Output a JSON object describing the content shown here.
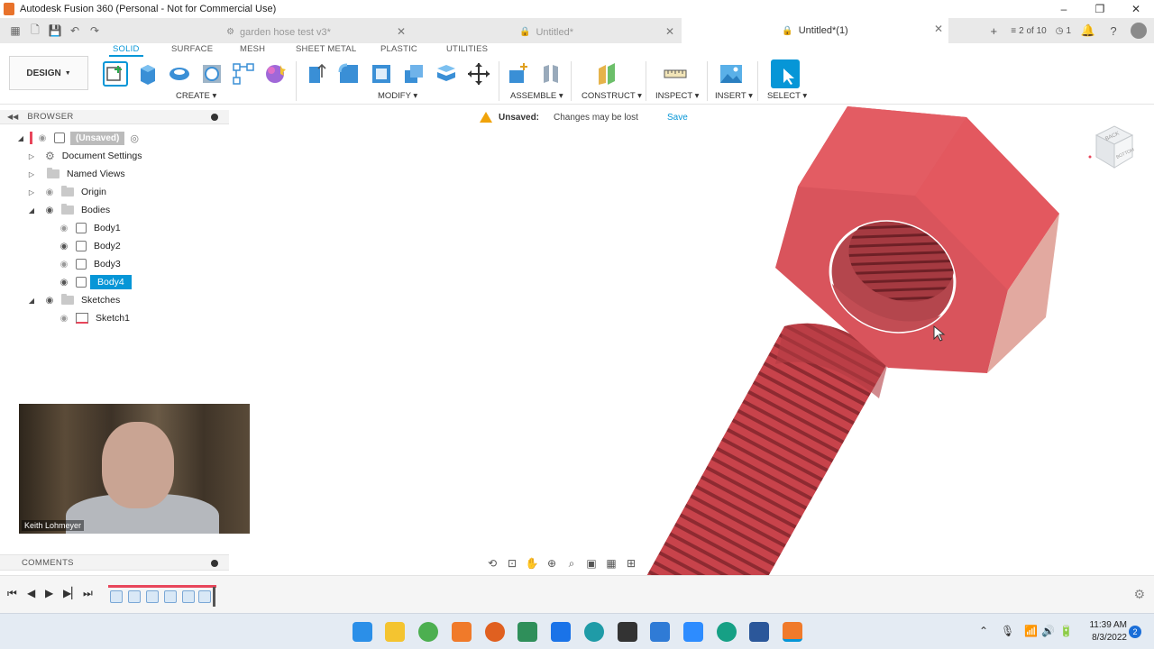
{
  "window": {
    "title": "Autodesk Fusion 360 (Personal - Not for Commercial Use)",
    "controls": [
      "–",
      "❐",
      "✕"
    ]
  },
  "tabs": [
    {
      "label": "garden hose test v3*",
      "active": false
    },
    {
      "label": "Untitled*",
      "active": false
    },
    {
      "label": "Untitled*(1)",
      "active": true
    }
  ],
  "tab_right": {
    "pages": "2 of 10",
    "jobs": "1"
  },
  "ribbon": {
    "workspace": "DESIGN",
    "tabs": [
      "SOLID",
      "SURFACE",
      "MESH",
      "SHEET METAL",
      "PLASTIC",
      "UTILITIES"
    ],
    "active_tab": "SOLID",
    "groups": [
      "CREATE",
      "MODIFY",
      "ASSEMBLE",
      "CONSTRUCT",
      "INSPECT",
      "INSERT",
      "SELECT"
    ]
  },
  "browser": {
    "title": "BROWSER",
    "root": "(Unsaved)",
    "items": [
      {
        "label": "Document Settings"
      },
      {
        "label": "Named Views"
      },
      {
        "label": "Origin"
      },
      {
        "label": "Bodies"
      },
      {
        "label": "Body1"
      },
      {
        "label": "Body2"
      },
      {
        "label": "Body3"
      },
      {
        "label": "Body4"
      },
      {
        "label": "Sketches"
      },
      {
        "label": "Sketch1"
      }
    ],
    "selected": "Body4"
  },
  "warning": {
    "label": "Unsaved:",
    "message": "Changes may be lost",
    "action": "Save"
  },
  "viewcube": {
    "faces": [
      "BACK",
      "BOTTOM"
    ]
  },
  "webcam": {
    "name": "Keith Lohmeyer"
  },
  "comments": {
    "title": "COMMENTS"
  },
  "clock": {
    "time": "11:39 AM",
    "date": "8/3/2022",
    "notifications": "2"
  },
  "colors": {
    "accent": "#0696d7",
    "model": "#e05a61",
    "warning": "#f0a30a"
  }
}
